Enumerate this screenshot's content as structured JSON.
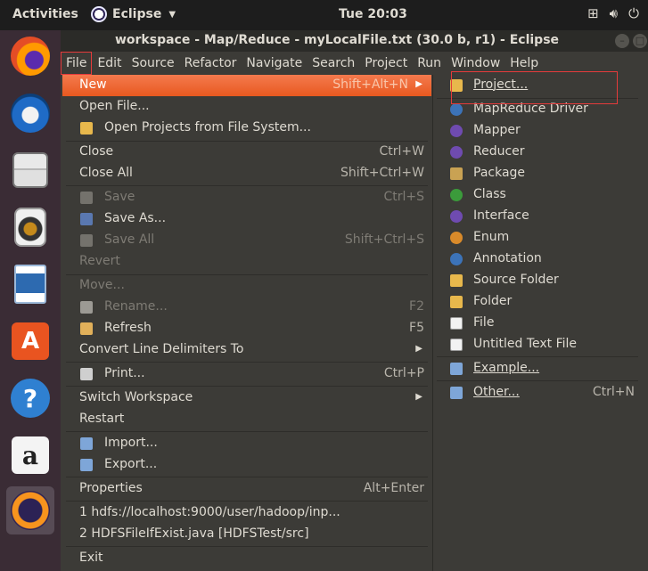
{
  "topbar": {
    "activities": "Activities",
    "app_name": "Eclipse",
    "clock": "Tue 20:03",
    "tray_icons": [
      "network-icon",
      "volume-icon",
      "power-icon"
    ]
  },
  "dock": {
    "items": [
      "firefox",
      "thunderbird",
      "files",
      "rhythmbox",
      "libreoffice-writer",
      "ubuntu-software",
      "help",
      "amazon",
      "eclipse"
    ]
  },
  "window": {
    "title": "workspace - Map/Reduce - myLocalFile.txt (30.0 b, r1) - Eclipse"
  },
  "menubar": {
    "items": [
      "File",
      "Edit",
      "Source",
      "Refactor",
      "Navigate",
      "Search",
      "Project",
      "Run",
      "Window",
      "Help"
    ]
  },
  "file_menu": {
    "new": "New",
    "new_key": "Shift+Alt+N",
    "open_file": "Open File...",
    "open_projects": "Open Projects from File System...",
    "close": "Close",
    "close_key": "Ctrl+W",
    "close_all": "Close All",
    "close_all_key": "Shift+Ctrl+W",
    "save": "Save",
    "save_key": "Ctrl+S",
    "save_as": "Save As...",
    "save_all": "Save All",
    "save_all_key": "Shift+Ctrl+S",
    "revert": "Revert",
    "move": "Move...",
    "rename": "Rename...",
    "rename_key": "F2",
    "refresh": "Refresh",
    "refresh_key": "F5",
    "convert": "Convert Line Delimiters To",
    "print": "Print...",
    "print_key": "Ctrl+P",
    "switch_workspace": "Switch Workspace",
    "restart": "Restart",
    "import": "Import...",
    "export": "Export...",
    "properties": "Properties",
    "properties_key": "Alt+Enter",
    "recent1": "1 hdfs://localhost:9000/user/hadoop/inp...",
    "recent2": "2 HDFSFileIfExist.java  [HDFSTest/src]",
    "exit": "Exit"
  },
  "new_submenu": {
    "project": "Project...",
    "mapreduce_driver": "MapReduce Driver",
    "mapper": "Mapper",
    "reducer": "Reducer",
    "package": "Package",
    "class": "Class",
    "interface": "Interface",
    "enum": "Enum",
    "annotation": "Annotation",
    "source_folder": "Source Folder",
    "folder": "Folder",
    "file": "File",
    "untitled_text_file": "Untitled Text File",
    "example": "Example...",
    "other": "Other...",
    "other_key": "Ctrl+N"
  },
  "colors": {
    "highlight": "#e8591f",
    "annotation_box": "#e53b3b",
    "menu_bg": "#3c3b37",
    "dock_bg": "#3a2c35"
  }
}
